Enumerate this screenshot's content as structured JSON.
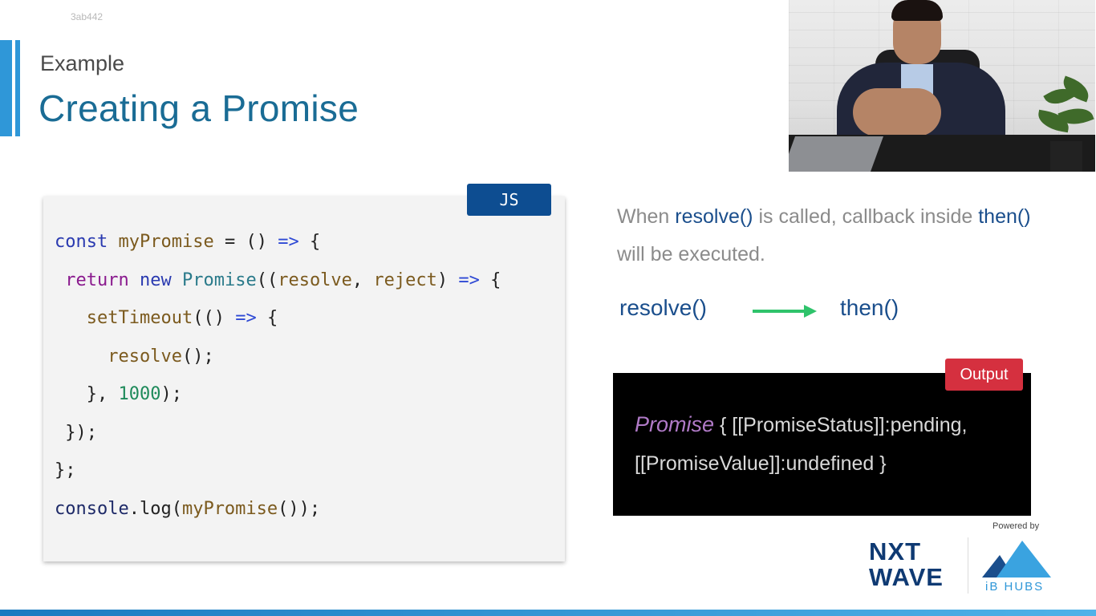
{
  "watermark": "3ab442",
  "slide": {
    "eyebrow": "Example",
    "title": "Creating a Promise"
  },
  "code_block": {
    "language_label": "JS",
    "tokens": {
      "l1": [
        "const",
        "myPromise",
        "=",
        "()",
        "=>",
        "{"
      ],
      "l2": [
        "return",
        "new",
        "Promise",
        "((",
        "resolve",
        ",",
        "reject",
        ")",
        "=>",
        "{"
      ],
      "l3": [
        "setTimeout",
        "(()",
        "=>",
        "{"
      ],
      "l4": [
        "resolve",
        "();"
      ],
      "l5": [
        "},",
        "1000",
        ");"
      ],
      "l6": [
        "});"
      ],
      "l7": [
        "};"
      ],
      "l8": [
        "console",
        ".log(",
        "myPromise",
        "());"
      ]
    }
  },
  "explanation": {
    "p1": "When ",
    "resolve": "resolve()",
    "p2": " is called, callback inside ",
    "then": "then()",
    "p3": " will be executed."
  },
  "flow": {
    "from": "resolve()",
    "to": "then()",
    "arrow_color": "#2fc36b"
  },
  "output": {
    "label": "Output",
    "promise_word": "Promise",
    "line1_rest": " { [[PromiseStatus]]:pending,",
    "line2": "[[PromiseValue]]:undefined }"
  },
  "branding": {
    "powered_by": "Powered by",
    "nxt_line1": "NXT",
    "nxt_line2": "WAVE",
    "ib_hubs": "iB HUBS"
  },
  "colors": {
    "title": "#1a6c95",
    "accent": "#2f97d8",
    "js_tag": "#0d4d91",
    "output_tag": "#d5303f"
  }
}
